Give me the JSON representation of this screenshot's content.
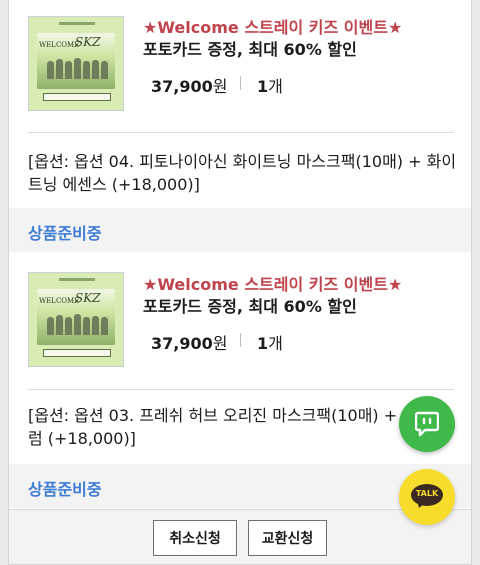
{
  "orders": [
    {
      "event_title": "★Welcome 스트레이 키즈 이벤트★",
      "promo_line": "포토카드 증정, 최대 60% 할인",
      "price": "37,900",
      "currency": "원",
      "quantity": "1",
      "quantity_unit": "개",
      "option_text": "[옵션: 옵션 04. 피토나이아신 화이트닝 마스크팩(10매) + 화이트닝 에센스 (+18,000)]",
      "status": "상품준비중"
    },
    {
      "event_title": "★Welcome 스트레이 키즈 이벤트★",
      "promo_line": "포토카드 증정, 최대 60% 할인",
      "price": "37,900",
      "currency": "원",
      "quantity": "1",
      "quantity_unit": "개",
      "option_text": "[옵션: 옵션 03. 프레쉬 허브 오리진 마스크팩(10매) + 오일세럼 (+18,000)]",
      "status": "상품준비중"
    }
  ],
  "thumbnail": {
    "welcome_text": "WELCOME",
    "logo_text": "SKZ"
  },
  "actions": {
    "cancel_label": "취소신청",
    "exchange_label": "교환신청"
  },
  "fab": {
    "talk_label": "TALK",
    "chat_icon": "chat-bubble-icon",
    "talk_icon": "kakaotalk-icon"
  },
  "colors": {
    "event_red": "#c0444d",
    "status_blue": "#3f7cd6",
    "chat_green": "#3fb94a",
    "talk_yellow": "#f7dc2c"
  }
}
